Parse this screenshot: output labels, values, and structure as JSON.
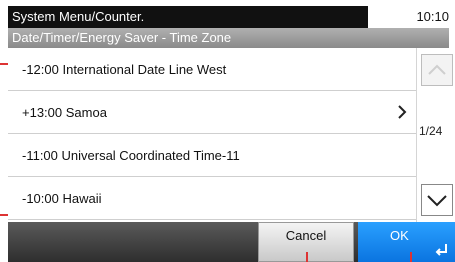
{
  "header": {
    "title": "System Menu/Counter.",
    "time": "10:10",
    "breadcrumb": "Date/Timer/Energy Saver - Time Zone"
  },
  "list": {
    "items": [
      {
        "label": "-12:00 International Date Line West",
        "has_chevron": false
      },
      {
        "label": "+13:00 Samoa",
        "has_chevron": true
      },
      {
        "label": "-11:00 Universal Coordinated Time-11",
        "has_chevron": false
      },
      {
        "label": "-10:00 Hawaii",
        "has_chevron": false
      }
    ]
  },
  "pager": {
    "indicator": "1/24"
  },
  "footer": {
    "cancel_label": "Cancel",
    "ok_label": "OK"
  },
  "colors": {
    "ok_accent": "#1a8cf0",
    "marker": "#d33333"
  }
}
